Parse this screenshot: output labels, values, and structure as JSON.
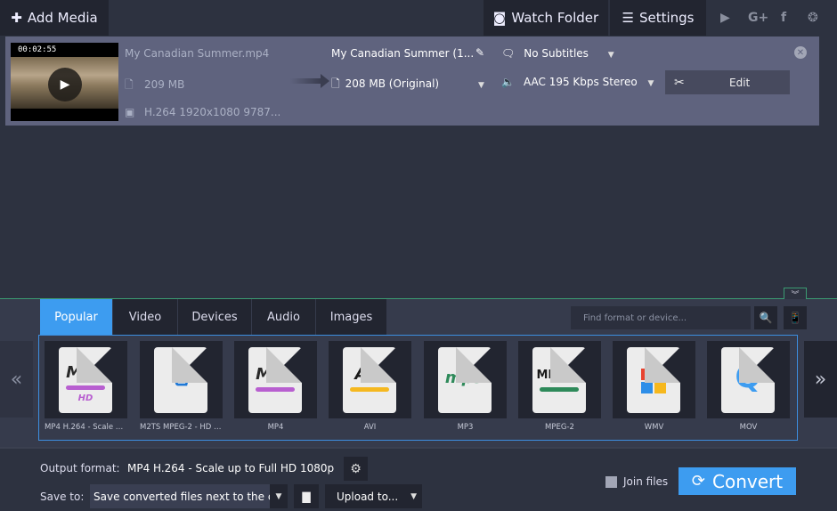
{
  "toolbar": {
    "add_media_label": "Add Media",
    "add_media_icon": "plus-icon",
    "watch_folder_label": "Watch Folder",
    "watch_folder_icon": "eye-folder-icon",
    "settings_label": "Settings",
    "settings_icon": "menu-icon",
    "social": [
      {
        "name": "youtube-icon",
        "glyph": "▶"
      },
      {
        "name": "google-plus-icon",
        "glyph": "G+"
      },
      {
        "name": "facebook-icon",
        "glyph": "f"
      },
      {
        "name": "film-reel-icon",
        "glyph": "❂"
      }
    ]
  },
  "file": {
    "duration": "00:02:55",
    "source_name": "My Canadian Summer.mp4",
    "source_size": "209 MB",
    "source_codec": "H.264 1920x1080 9787...",
    "output_name": "My Canadian Summer (1...",
    "output_size": "208 MB (Original)",
    "subtitles": "No Subtitles",
    "audio": "AAC 195 Kbps Stereo",
    "edit_label": "Edit"
  },
  "formats_panel": {
    "tabs": [
      {
        "label": "Popular",
        "active": true
      },
      {
        "label": "Video",
        "active": false
      },
      {
        "label": "Devices",
        "active": false
      },
      {
        "label": "Audio",
        "active": false
      },
      {
        "label": "Images",
        "active": false
      }
    ],
    "search_placeholder": "Find format or device...",
    "prev_label": "«",
    "next_label": "»",
    "items": [
      {
        "label": "MP4 H.264 - Scale up...",
        "logo": "MP4",
        "sub": "HD",
        "pill_color": "#b85fd0",
        "logo_color": "#2a2a2a"
      },
      {
        "label": "M2TS MPEG-2 - HD 7...",
        "logo": "blu-ray",
        "sub": "",
        "pill_color": "",
        "logo_color": "#1e78d6"
      },
      {
        "label": "MP4",
        "logo": "MP4",
        "sub": "",
        "pill_color": "#b85fd0",
        "logo_color": "#2a2a2a"
      },
      {
        "label": "AVI",
        "logo": "AVI",
        "sub": "",
        "pill_color": "#f5b820",
        "logo_color": "#1a1a1a"
      },
      {
        "label": "MP3",
        "logo": "mp3",
        "sub": "",
        "pill_color": "",
        "logo_color": "#2e8a5a"
      },
      {
        "label": "MPEG-2",
        "logo": "MPEG2",
        "sub": "",
        "pill_color": "#2e8a5a",
        "logo_color": "#1a1a1a"
      },
      {
        "label": "WMV",
        "logo": "windows",
        "sub": "",
        "pill_color": "",
        "logo_color": ""
      },
      {
        "label": "MOV",
        "logo": "Q",
        "sub": "",
        "pill_color": "",
        "logo_color": "#3d9cf0"
      }
    ]
  },
  "bottom": {
    "output_format_label": "Output format:",
    "output_format_value": "MP4 H.264 - Scale up to Full HD 1080p",
    "save_to_label": "Save to:",
    "save_to_value": "Save converted files next to the c",
    "upload_label": "Upload to...",
    "join_files_label": "Join files",
    "join_files_checked": false,
    "convert_label": "Convert"
  },
  "colors": {
    "accent": "#3d9cf0",
    "divider": "#3b9b72"
  }
}
